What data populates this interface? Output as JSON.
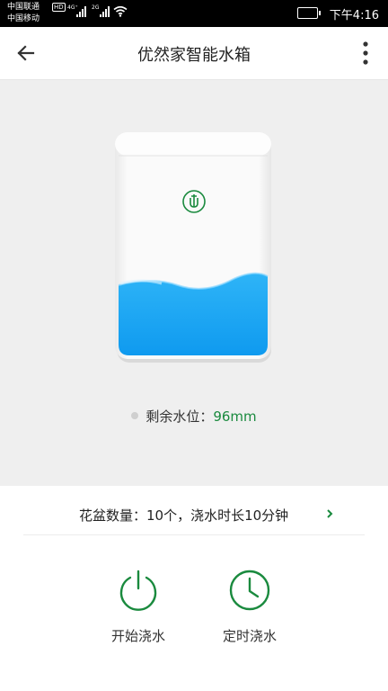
{
  "status_bar": {
    "carrier1": "中国联通",
    "carrier1_badge": "HD",
    "carrier2": "中国移动",
    "network1": "4G⁺",
    "network2": "2G",
    "time": "下午4:16"
  },
  "header": {
    "title": "优然家智能水箱",
    "back_icon": "arrow-left-icon",
    "menu_icon": "more-vert-icon"
  },
  "tank": {
    "level_label": "剩余水位：",
    "level_value": "96mm",
    "logo_icon": "tank-logo-icon"
  },
  "info": {
    "text": "花盆数量：10个，浇水时长10分钟",
    "chevron_icon": "chevron-right-icon"
  },
  "actions": [
    {
      "label": "开始浇水",
      "icon": "power-icon"
    },
    {
      "label": "定时浇水",
      "icon": "clock-icon"
    }
  ],
  "colors": {
    "accent": "#1a8a3e",
    "water": "#1aa6f2",
    "hero_bg": "#efefef"
  }
}
